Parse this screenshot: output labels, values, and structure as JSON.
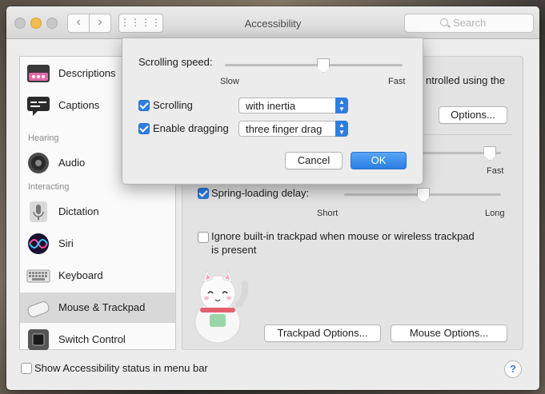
{
  "window": {
    "title": "Accessibility",
    "search_placeholder": "Search"
  },
  "sidebar": {
    "items": [
      {
        "label": "Descriptions",
        "icon": "descriptions-icon"
      },
      {
        "label": "Captions",
        "icon": "captions-icon"
      },
      {
        "label": "Audio",
        "icon": "speaker-icon"
      },
      {
        "label": "Dictation",
        "icon": "microphone-icon"
      },
      {
        "label": "Siri",
        "icon": "siri-icon"
      },
      {
        "label": "Keyboard",
        "icon": "keyboard-icon"
      },
      {
        "label": "Mouse & Trackpad",
        "icon": "mouse-icon",
        "selected": true
      },
      {
        "label": "Switch Control",
        "icon": "switch-control-icon"
      }
    ],
    "headers": {
      "hearing": "Hearing",
      "interacting": "Interacting"
    }
  },
  "panel": {
    "partial_text": "ntrolled using the",
    "options_button": "Options...",
    "fast_label": "Fast",
    "spring_loading": {
      "label": "Spring-loading delay:",
      "checked": true,
      "min_label": "Short",
      "max_label": "Long",
      "value": 0.5
    },
    "double_click_speed_value": 0.85,
    "ignore_trackpad": {
      "label_line1": "Ignore built-in trackpad when mouse or wireless trackpad",
      "label_line2": "is present",
      "checked": false
    },
    "trackpad_options_button": "Trackpad Options...",
    "mouse_options_button": "Mouse Options..."
  },
  "footer": {
    "status_checkbox_label": "Show Accessibility status in menu bar",
    "checked": false,
    "help": "?"
  },
  "dialog": {
    "scrolling_speed": {
      "label": "Scrolling speed:",
      "min_label": "Slow",
      "max_label": "Fast",
      "value": 0.55
    },
    "scrolling": {
      "label": "Scrolling",
      "checked": true,
      "popup_value": "with inertia"
    },
    "dragging": {
      "label": "Enable dragging",
      "checked": true,
      "popup_value": "three finger drag"
    },
    "cancel_button": "Cancel",
    "ok_button": "OK"
  },
  "colors": {
    "accent": "#2f7de1",
    "window_bg": "#ececec",
    "panel_bg": "#e3e3e3"
  }
}
